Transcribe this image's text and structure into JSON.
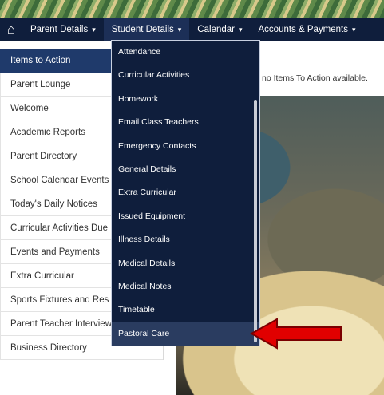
{
  "navbar": {
    "home_icon": "home-icon",
    "items": [
      {
        "label": "Parent Details",
        "caret": "▾"
      },
      {
        "label": "Student Details",
        "caret": "▾"
      },
      {
        "label": "Calendar",
        "caret": "▾"
      },
      {
        "label": "Accounts & Payments",
        "caret": "▾"
      }
    ]
  },
  "sidebar": {
    "items": [
      {
        "label": "Items to Action"
      },
      {
        "label": "Parent Lounge"
      },
      {
        "label": "Welcome"
      },
      {
        "label": "Academic Reports"
      },
      {
        "label": "Parent Directory"
      },
      {
        "label": "School Calendar Events"
      },
      {
        "label": "Today's Daily Notices"
      },
      {
        "label": "Curricular Activities Due"
      },
      {
        "label": "Events and Payments"
      },
      {
        "label": "Extra Curricular"
      },
      {
        "label": "Sports Fixtures and Res"
      },
      {
        "label": "Parent Teacher Interview"
      },
      {
        "label": "Business Directory"
      }
    ]
  },
  "dropdown": {
    "items": [
      {
        "label": "Attendance"
      },
      {
        "label": "Curricular Activities"
      },
      {
        "label": "Homework"
      },
      {
        "label": "Email Class Teachers"
      },
      {
        "label": "Emergency Contacts"
      },
      {
        "label": "General Details"
      },
      {
        "label": "Extra Curricular"
      },
      {
        "label": "Issued Equipment"
      },
      {
        "label": "Illness Details"
      },
      {
        "label": "Medical Details"
      },
      {
        "label": "Medical Notes"
      },
      {
        "label": "Timetable"
      },
      {
        "label": "Pastoral Care"
      }
    ]
  },
  "main": {
    "notice": "no Items To Action available."
  },
  "colors": {
    "navbar": "#0f1e3c",
    "sidebar_active": "#1f3a6b",
    "arrow": "#e10000"
  }
}
